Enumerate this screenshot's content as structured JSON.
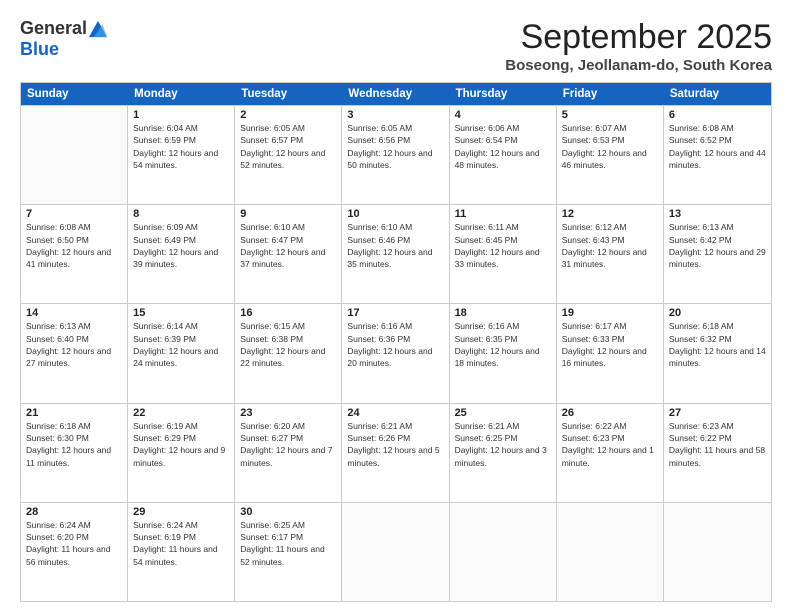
{
  "logo": {
    "general": "General",
    "blue": "Blue"
  },
  "header": {
    "month": "September 2025",
    "location": "Boseong, Jeollanam-do, South Korea"
  },
  "days": [
    "Sunday",
    "Monday",
    "Tuesday",
    "Wednesday",
    "Thursday",
    "Friday",
    "Saturday"
  ],
  "weeks": [
    [
      {
        "day": "",
        "sunrise": "",
        "sunset": "",
        "daylight": ""
      },
      {
        "day": "1",
        "sunrise": "Sunrise: 6:04 AM",
        "sunset": "Sunset: 6:59 PM",
        "daylight": "Daylight: 12 hours and 54 minutes."
      },
      {
        "day": "2",
        "sunrise": "Sunrise: 6:05 AM",
        "sunset": "Sunset: 6:57 PM",
        "daylight": "Daylight: 12 hours and 52 minutes."
      },
      {
        "day": "3",
        "sunrise": "Sunrise: 6:05 AM",
        "sunset": "Sunset: 6:56 PM",
        "daylight": "Daylight: 12 hours and 50 minutes."
      },
      {
        "day": "4",
        "sunrise": "Sunrise: 6:06 AM",
        "sunset": "Sunset: 6:54 PM",
        "daylight": "Daylight: 12 hours and 48 minutes."
      },
      {
        "day": "5",
        "sunrise": "Sunrise: 6:07 AM",
        "sunset": "Sunset: 6:53 PM",
        "daylight": "Daylight: 12 hours and 46 minutes."
      },
      {
        "day": "6",
        "sunrise": "Sunrise: 6:08 AM",
        "sunset": "Sunset: 6:52 PM",
        "daylight": "Daylight: 12 hours and 44 minutes."
      }
    ],
    [
      {
        "day": "7",
        "sunrise": "Sunrise: 6:08 AM",
        "sunset": "Sunset: 6:50 PM",
        "daylight": "Daylight: 12 hours and 41 minutes."
      },
      {
        "day": "8",
        "sunrise": "Sunrise: 6:09 AM",
        "sunset": "Sunset: 6:49 PM",
        "daylight": "Daylight: 12 hours and 39 minutes."
      },
      {
        "day": "9",
        "sunrise": "Sunrise: 6:10 AM",
        "sunset": "Sunset: 6:47 PM",
        "daylight": "Daylight: 12 hours and 37 minutes."
      },
      {
        "day": "10",
        "sunrise": "Sunrise: 6:10 AM",
        "sunset": "Sunset: 6:46 PM",
        "daylight": "Daylight: 12 hours and 35 minutes."
      },
      {
        "day": "11",
        "sunrise": "Sunrise: 6:11 AM",
        "sunset": "Sunset: 6:45 PM",
        "daylight": "Daylight: 12 hours and 33 minutes."
      },
      {
        "day": "12",
        "sunrise": "Sunrise: 6:12 AM",
        "sunset": "Sunset: 6:43 PM",
        "daylight": "Daylight: 12 hours and 31 minutes."
      },
      {
        "day": "13",
        "sunrise": "Sunrise: 6:13 AM",
        "sunset": "Sunset: 6:42 PM",
        "daylight": "Daylight: 12 hours and 29 minutes."
      }
    ],
    [
      {
        "day": "14",
        "sunrise": "Sunrise: 6:13 AM",
        "sunset": "Sunset: 6:40 PM",
        "daylight": "Daylight: 12 hours and 27 minutes."
      },
      {
        "day": "15",
        "sunrise": "Sunrise: 6:14 AM",
        "sunset": "Sunset: 6:39 PM",
        "daylight": "Daylight: 12 hours and 24 minutes."
      },
      {
        "day": "16",
        "sunrise": "Sunrise: 6:15 AM",
        "sunset": "Sunset: 6:38 PM",
        "daylight": "Daylight: 12 hours and 22 minutes."
      },
      {
        "day": "17",
        "sunrise": "Sunrise: 6:16 AM",
        "sunset": "Sunset: 6:36 PM",
        "daylight": "Daylight: 12 hours and 20 minutes."
      },
      {
        "day": "18",
        "sunrise": "Sunrise: 6:16 AM",
        "sunset": "Sunset: 6:35 PM",
        "daylight": "Daylight: 12 hours and 18 minutes."
      },
      {
        "day": "19",
        "sunrise": "Sunrise: 6:17 AM",
        "sunset": "Sunset: 6:33 PM",
        "daylight": "Daylight: 12 hours and 16 minutes."
      },
      {
        "day": "20",
        "sunrise": "Sunrise: 6:18 AM",
        "sunset": "Sunset: 6:32 PM",
        "daylight": "Daylight: 12 hours and 14 minutes."
      }
    ],
    [
      {
        "day": "21",
        "sunrise": "Sunrise: 6:18 AM",
        "sunset": "Sunset: 6:30 PM",
        "daylight": "Daylight: 12 hours and 11 minutes."
      },
      {
        "day": "22",
        "sunrise": "Sunrise: 6:19 AM",
        "sunset": "Sunset: 6:29 PM",
        "daylight": "Daylight: 12 hours and 9 minutes."
      },
      {
        "day": "23",
        "sunrise": "Sunrise: 6:20 AM",
        "sunset": "Sunset: 6:27 PM",
        "daylight": "Daylight: 12 hours and 7 minutes."
      },
      {
        "day": "24",
        "sunrise": "Sunrise: 6:21 AM",
        "sunset": "Sunset: 6:26 PM",
        "daylight": "Daylight: 12 hours and 5 minutes."
      },
      {
        "day": "25",
        "sunrise": "Sunrise: 6:21 AM",
        "sunset": "Sunset: 6:25 PM",
        "daylight": "Daylight: 12 hours and 3 minutes."
      },
      {
        "day": "26",
        "sunrise": "Sunrise: 6:22 AM",
        "sunset": "Sunset: 6:23 PM",
        "daylight": "Daylight: 12 hours and 1 minute."
      },
      {
        "day": "27",
        "sunrise": "Sunrise: 6:23 AM",
        "sunset": "Sunset: 6:22 PM",
        "daylight": "Daylight: 11 hours and 58 minutes."
      }
    ],
    [
      {
        "day": "28",
        "sunrise": "Sunrise: 6:24 AM",
        "sunset": "Sunset: 6:20 PM",
        "daylight": "Daylight: 11 hours and 56 minutes."
      },
      {
        "day": "29",
        "sunrise": "Sunrise: 6:24 AM",
        "sunset": "Sunset: 6:19 PM",
        "daylight": "Daylight: 11 hours and 54 minutes."
      },
      {
        "day": "30",
        "sunrise": "Sunrise: 6:25 AM",
        "sunset": "Sunset: 6:17 PM",
        "daylight": "Daylight: 11 hours and 52 minutes."
      },
      {
        "day": "",
        "sunrise": "",
        "sunset": "",
        "daylight": ""
      },
      {
        "day": "",
        "sunrise": "",
        "sunset": "",
        "daylight": ""
      },
      {
        "day": "",
        "sunrise": "",
        "sunset": "",
        "daylight": ""
      },
      {
        "day": "",
        "sunrise": "",
        "sunset": "",
        "daylight": ""
      }
    ]
  ]
}
